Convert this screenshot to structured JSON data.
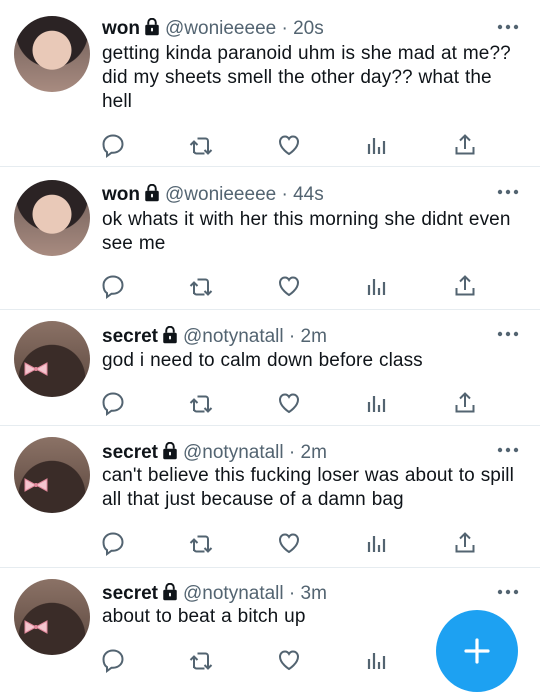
{
  "tweets": [
    {
      "name": "won",
      "handle": "@wonieeeee",
      "dot": "·",
      "time": "20s",
      "avatar": "won-avatar",
      "text": "getting kinda paranoid uhm is she mad at me?? did my sheets smell the other day?? what the hell"
    },
    {
      "name": "won",
      "handle": "@wonieeeee",
      "dot": "·",
      "time": "44s",
      "avatar": "won-avatar",
      "text": "ok whats it with her this morning she didnt even see me"
    },
    {
      "name": "secret",
      "handle": "@notynatall",
      "dot": "·",
      "time": "2m",
      "avatar": "secret-avatar",
      "text": "god i need to calm down before class"
    },
    {
      "name": "secret",
      "handle": "@notynatall",
      "dot": "·",
      "time": "2m",
      "avatar": "secret-avatar",
      "text": "can't believe this fucking loser was about to spill all that just because of a damn bag"
    },
    {
      "name": "secret",
      "handle": "@notynatall",
      "dot": "·",
      "time": "3m",
      "avatar": "secret-avatar",
      "text": "about to beat a bitch up"
    }
  ],
  "icons": {
    "lock": "lock-icon",
    "more": "more-icon",
    "reply": "reply-icon",
    "retweet": "retweet-icon",
    "like": "heart-icon",
    "views": "views-icon",
    "share": "share-icon",
    "compose": "plus-icon"
  },
  "colors": {
    "accent": "#1da1f2",
    "icon": "#536471",
    "text": "#0f1419"
  }
}
